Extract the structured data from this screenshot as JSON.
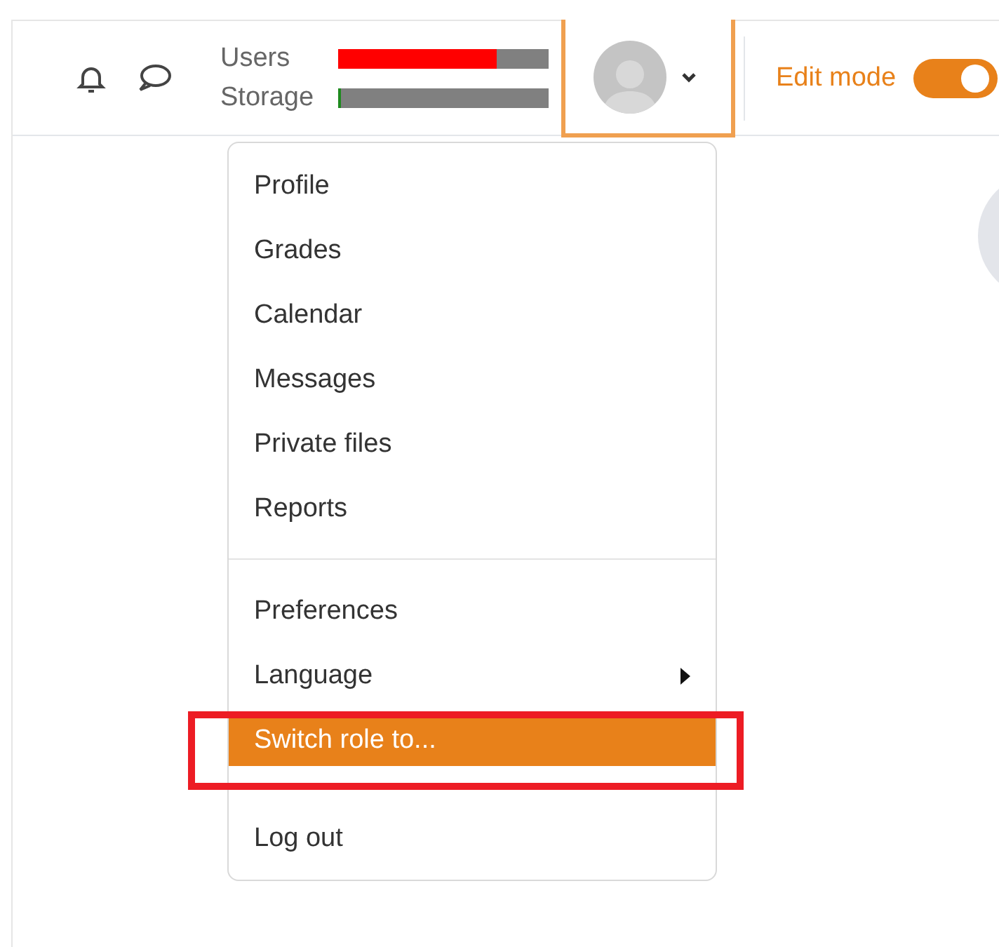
{
  "header": {
    "quotas": [
      {
        "label": "Users",
        "level": 0.75,
        "color": "#ff0000"
      },
      {
        "label": "Storage",
        "level": 0.01,
        "color": "#1e8a1e"
      }
    ],
    "user_menu": {
      "expanded": true
    },
    "edit_mode": {
      "label": "Edit mode",
      "on": true
    }
  },
  "menu": {
    "groups": [
      [
        {
          "label": "Profile",
          "selected": false,
          "submenu": false
        },
        {
          "label": "Grades",
          "selected": false,
          "submenu": false
        },
        {
          "label": "Calendar",
          "selected": false,
          "submenu": false
        },
        {
          "label": "Messages",
          "selected": false,
          "submenu": false
        },
        {
          "label": "Private files",
          "selected": false,
          "submenu": false
        },
        {
          "label": "Reports",
          "selected": false,
          "submenu": false
        }
      ],
      [
        {
          "label": "Preferences",
          "selected": false,
          "submenu": false
        },
        {
          "label": "Language",
          "selected": false,
          "submenu": true
        },
        {
          "label": "Switch role to...",
          "selected": true,
          "submenu": false
        }
      ],
      [
        {
          "label": "Log out",
          "selected": false,
          "submenu": false
        }
      ]
    ]
  }
}
